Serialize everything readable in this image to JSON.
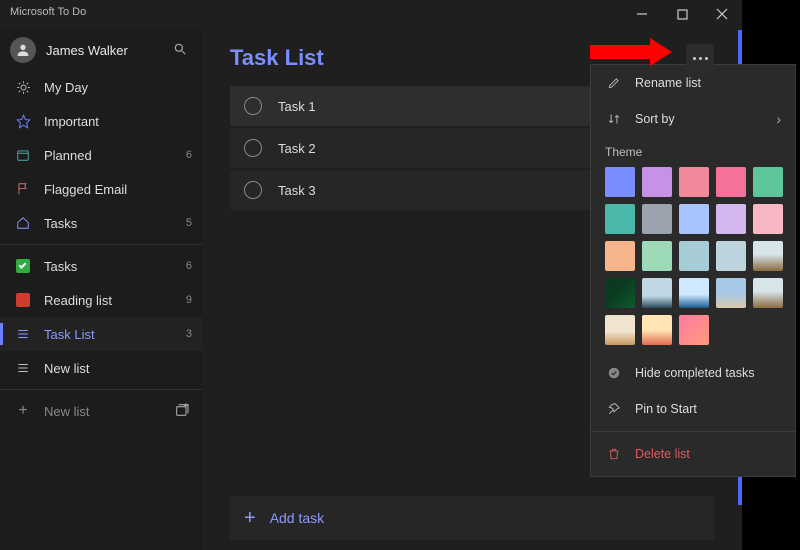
{
  "app_name": "Microsoft To Do",
  "user": {
    "name": "James Walker"
  },
  "sidebar": {
    "smart": [
      {
        "icon": "sun",
        "label": "My Day",
        "count": ""
      },
      {
        "icon": "star",
        "label": "Important",
        "count": ""
      },
      {
        "icon": "cal",
        "label": "Planned",
        "count": "6"
      },
      {
        "icon": "flag",
        "label": "Flagged Email",
        "count": ""
      },
      {
        "icon": "home",
        "label": "Tasks",
        "count": "5"
      }
    ],
    "lists": [
      {
        "icon": "green",
        "label": "Tasks",
        "count": "6",
        "active": false
      },
      {
        "icon": "red",
        "label": "Reading list",
        "count": "9",
        "active": false
      },
      {
        "icon": "blank",
        "label": "Task List",
        "count": "3",
        "active": true
      },
      {
        "icon": "blank",
        "label": "New list",
        "count": "",
        "active": false
      }
    ],
    "new_list_label": "New list"
  },
  "main": {
    "title": "Task List",
    "tasks": [
      {
        "label": "Task 1"
      },
      {
        "label": "Task 2"
      },
      {
        "label": "Task 3"
      }
    ],
    "add_task_label": "Add task"
  },
  "menu": {
    "rename": "Rename list",
    "sort": "Sort by",
    "theme_header": "Theme",
    "hide_completed": "Hide completed tasks",
    "pin": "Pin to Start",
    "delete": "Delete list",
    "colors": [
      "#7a8dff",
      "#c792e6",
      "#f08a9a",
      "#f4729a",
      "#5ec79a",
      "#4bb8a9",
      "#9aa3ad",
      "#a7c4ff",
      "#d3b8f0",
      "#f7b8c4",
      "#f5b48a",
      "#9ed9b8",
      "#a6cdd6",
      "#bcd4dd",
      "scn5",
      "scn1",
      "scn2",
      "scn3",
      "scn4",
      "scn5b",
      "scn6",
      "scn7",
      "scn8"
    ],
    "selected_index": 0
  }
}
